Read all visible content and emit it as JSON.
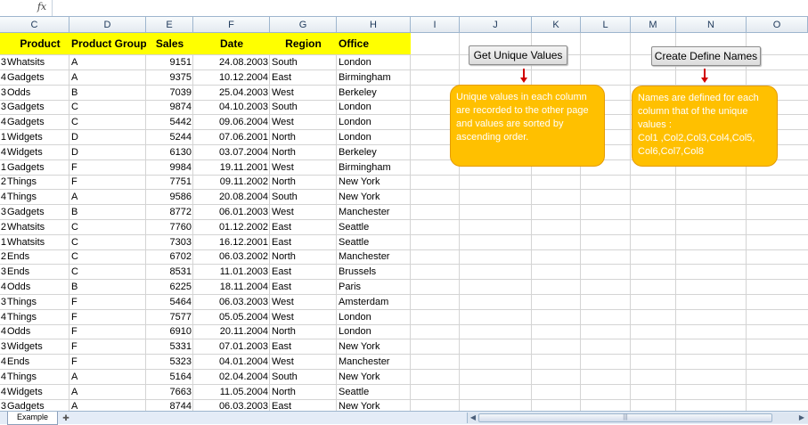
{
  "formula_bar": {
    "fx_label": "fx",
    "content": ""
  },
  "columns": [
    "C",
    "D",
    "E",
    "F",
    "G",
    "H",
    "I",
    "J",
    "K",
    "L",
    "M",
    "N",
    "O"
  ],
  "headers": {
    "product": "Product",
    "group": "Product Group",
    "sales": "Sales",
    "date": "Date",
    "region": "Region",
    "office": "Office"
  },
  "rows": [
    {
      "pre": "3",
      "product": "Whatsits",
      "group": "A",
      "sales": "9151",
      "date": "24.08.2003",
      "region": "South",
      "office": "London"
    },
    {
      "pre": "4",
      "product": "Gadgets",
      "group": "A",
      "sales": "9375",
      "date": "10.12.2004",
      "region": "East",
      "office": "Birmingham"
    },
    {
      "pre": "3",
      "product": "Odds",
      "group": "B",
      "sales": "7039",
      "date": "25.04.2003",
      "region": "West",
      "office": "Berkeley"
    },
    {
      "pre": "3",
      "product": "Gadgets",
      "group": "C",
      "sales": "9874",
      "date": "04.10.2003",
      "region": "South",
      "office": "London"
    },
    {
      "pre": "4",
      "product": "Gadgets",
      "group": "C",
      "sales": "5442",
      "date": "09.06.2004",
      "region": "West",
      "office": "London"
    },
    {
      "pre": "1",
      "product": "Widgets",
      "group": "D",
      "sales": "5244",
      "date": "07.06.2001",
      "region": "North",
      "office": "London"
    },
    {
      "pre": "4",
      "product": "Widgets",
      "group": "D",
      "sales": "6130",
      "date": "03.07.2004",
      "region": "North",
      "office": "Berkeley"
    },
    {
      "pre": "1",
      "product": "Gadgets",
      "group": "F",
      "sales": "9984",
      "date": "19.11.2001",
      "region": "West",
      "office": "Birmingham"
    },
    {
      "pre": "2",
      "product": "Things",
      "group": "F",
      "sales": "7751",
      "date": "09.11.2002",
      "region": "North",
      "office": "New York"
    },
    {
      "pre": "4",
      "product": "Things",
      "group": "A",
      "sales": "9586",
      "date": "20.08.2004",
      "region": "South",
      "office": "New York"
    },
    {
      "pre": "3",
      "product": "Gadgets",
      "group": "B",
      "sales": "8772",
      "date": "06.01.2003",
      "region": "West",
      "office": "Manchester"
    },
    {
      "pre": "2",
      "product": "Whatsits",
      "group": "C",
      "sales": "7760",
      "date": "01.12.2002",
      "region": "East",
      "office": "Seattle"
    },
    {
      "pre": "1",
      "product": "Whatsits",
      "group": "C",
      "sales": "7303",
      "date": "16.12.2001",
      "region": "East",
      "office": "Seattle"
    },
    {
      "pre": "2",
      "product": "Ends",
      "group": "C",
      "sales": "6702",
      "date": "06.03.2002",
      "region": "North",
      "office": "Manchester"
    },
    {
      "pre": "3",
      "product": "Ends",
      "group": "C",
      "sales": "8531",
      "date": "11.01.2003",
      "region": "East",
      "office": "Brussels"
    },
    {
      "pre": "4",
      "product": "Odds",
      "group": "B",
      "sales": "6225",
      "date": "18.11.2004",
      "region": "East",
      "office": "Paris"
    },
    {
      "pre": "3",
      "product": "Things",
      "group": "F",
      "sales": "5464",
      "date": "06.03.2003",
      "region": "West",
      "office": "Amsterdam"
    },
    {
      "pre": "4",
      "product": "Things",
      "group": "F",
      "sales": "7577",
      "date": "05.05.2004",
      "region": "West",
      "office": "London"
    },
    {
      "pre": "4",
      "product": "Odds",
      "group": "F",
      "sales": "6910",
      "date": "20.11.2004",
      "region": "North",
      "office": "London"
    },
    {
      "pre": "3",
      "product": "Widgets",
      "group": "F",
      "sales": "5331",
      "date": "07.01.2003",
      "region": "East",
      "office": "New York"
    },
    {
      "pre": "4",
      "product": "Ends",
      "group": "F",
      "sales": "5323",
      "date": "04.01.2004",
      "region": "West",
      "office": "Manchester"
    },
    {
      "pre": "4",
      "product": "Things",
      "group": "A",
      "sales": "5164",
      "date": "02.04.2004",
      "region": "South",
      "office": "New York"
    },
    {
      "pre": "4",
      "product": "Widgets",
      "group": "A",
      "sales": "7663",
      "date": "11.05.2004",
      "region": "North",
      "office": "Seattle"
    },
    {
      "pre": "3",
      "product": "Gadgets",
      "group": "A",
      "sales": "8744",
      "date": "06.03.2003",
      "region": "East",
      "office": "New York"
    }
  ],
  "buttons": {
    "unique": "Get Unique Values",
    "define": "Create Define Names"
  },
  "callouts": {
    "unique": "Unique values in each column are recorded to the other page and values are sorted by ascending order.",
    "define": "Names are defined for each column that  of the unique values :\nCol1 ,Col2,Col3,Col4,Col5, Col6,Col7,Col8"
  },
  "sheet_tab": "Example",
  "colors": {
    "header_fill": "#ffff00",
    "callout_fill": "#ffc000",
    "arrow": "#d00000"
  }
}
